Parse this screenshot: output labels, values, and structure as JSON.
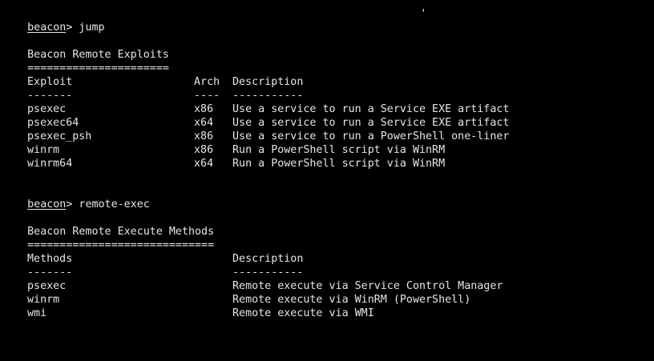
{
  "colors": {
    "background": "#000000",
    "foreground": "#e6e6e6"
  },
  "terminal": {
    "clipped_top_line": "                                                             '",
    "session_one": {
      "prompt_word": "beacon",
      "prompt_suffix": ">",
      "command": " jump",
      "section_title": "Beacon Remote Exploits",
      "section_rule": "======================",
      "headers": {
        "exploit": "Exploit",
        "arch": "Arch",
        "description": "Description"
      },
      "header_rules": {
        "exploit": "-------",
        "arch": "----",
        "description": "-----------"
      },
      "rows": [
        {
          "exploit": "psexec",
          "arch": "x86",
          "description": "Use a service to run a Service EXE artifact"
        },
        {
          "exploit": "psexec64",
          "arch": "x64",
          "description": "Use a service to run a Service EXE artifact"
        },
        {
          "exploit": "psexec_psh",
          "arch": "x86",
          "description": "Use a service to run a PowerShell one-liner"
        },
        {
          "exploit": "winrm",
          "arch": "x86",
          "description": "Run a PowerShell script via WinRM"
        },
        {
          "exploit": "winrm64",
          "arch": "x64",
          "description": "Run a PowerShell script via WinRM"
        }
      ]
    },
    "session_two": {
      "prompt_word": "beacon",
      "prompt_suffix": ">",
      "command": " remote-exec",
      "section_title": "Beacon Remote Execute Methods",
      "section_rule": "=============================",
      "headers": {
        "methods": "Methods",
        "description": "Description"
      },
      "header_rules": {
        "methods": "-------",
        "description": "-----------"
      },
      "rows": [
        {
          "method": "psexec",
          "description": "Remote execute via Service Control Manager"
        },
        {
          "method": "winrm",
          "description": "Remote execute via WinRM (PowerShell)"
        },
        {
          "method": "wmi",
          "description": "Remote execute via WMI"
        }
      ]
    }
  }
}
